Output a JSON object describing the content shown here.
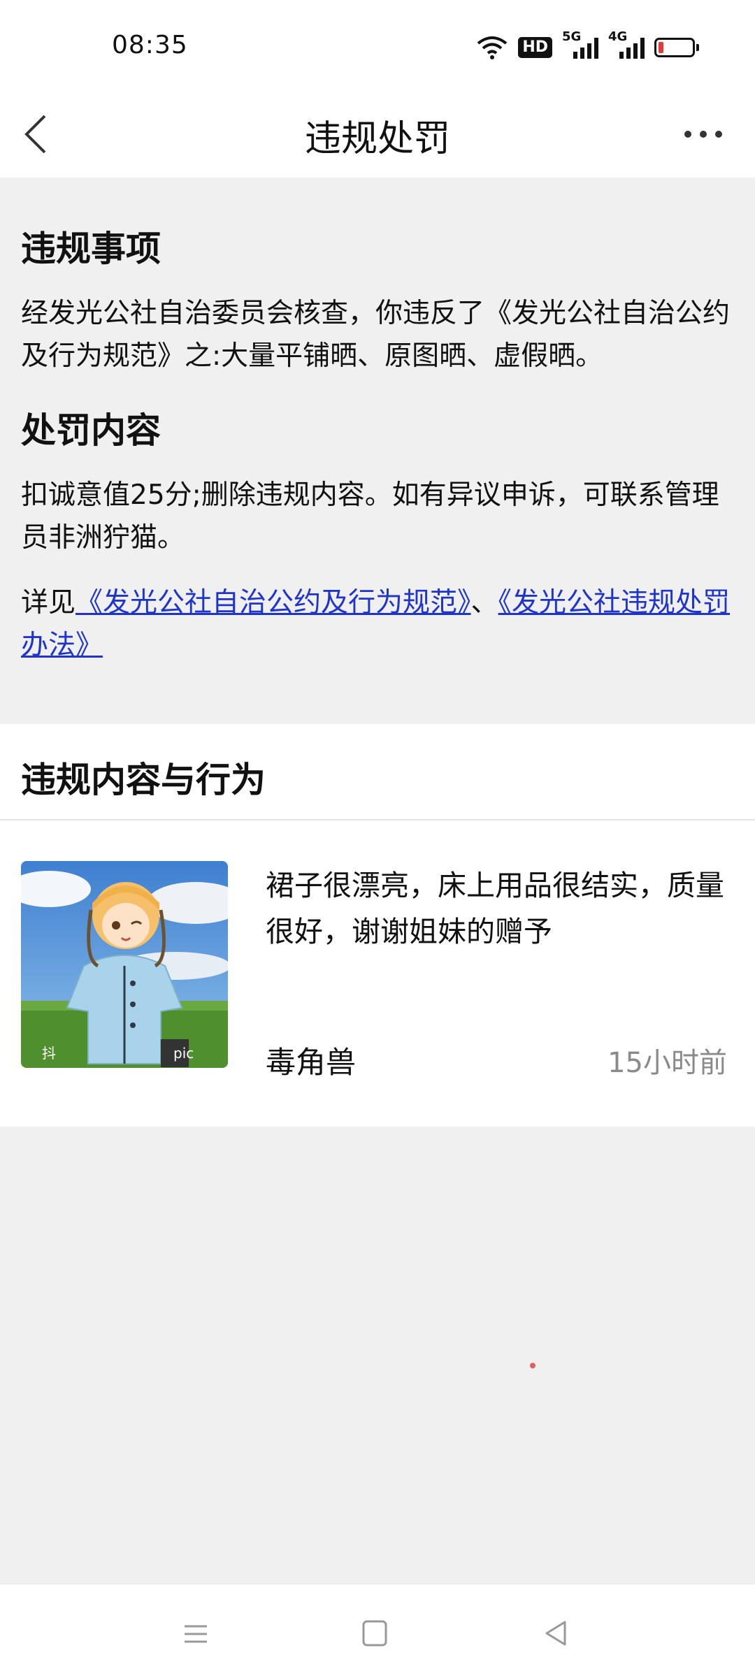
{
  "status_bar": {
    "time": "08:35",
    "icons": [
      "wifi-icon",
      "hd-icon",
      "signal-5g-icon",
      "signal-4g-icon",
      "battery-icon"
    ],
    "hd_label": "HD",
    "net1_label": "5G",
    "net2_label": "4G",
    "battery_color": "#e03a3a"
  },
  "header": {
    "title": "违规处罚",
    "back_icon": "chevron-left-icon",
    "more_icon": "more-horizontal-icon"
  },
  "violation": {
    "heading": "违规事项",
    "text": "经发光公社自治委员会核查，你违反了《发光公社自治公约及行为规范》之:大量平铺晒、原图晒、虚假晒。"
  },
  "penalty": {
    "heading": "处罚内容",
    "text": "扣诚意值25分;删除违规内容。如有异议申诉，可联系管理员非洲狞猫。",
    "see_prefix": "详见",
    "link1": "《发光公社自治公约及行为规范》",
    "separator": "、",
    "link2": "《发光公社违规处罚办法》",
    "link_color": "#1f35c9"
  },
  "content_card": {
    "heading": "违规内容与行为",
    "post": {
      "text": "裙子很漂亮，床上用品很结实，质量很好，谢谢姐妹的赠予",
      "author": "毒角兽",
      "time_ago": "15小时前",
      "thumbnail_watermark": "抖",
      "thumbnail_watermark2": "pic"
    }
  },
  "nav_bar": {
    "icons": [
      "menu-icon",
      "home-square-icon",
      "back-triangle-icon"
    ]
  }
}
